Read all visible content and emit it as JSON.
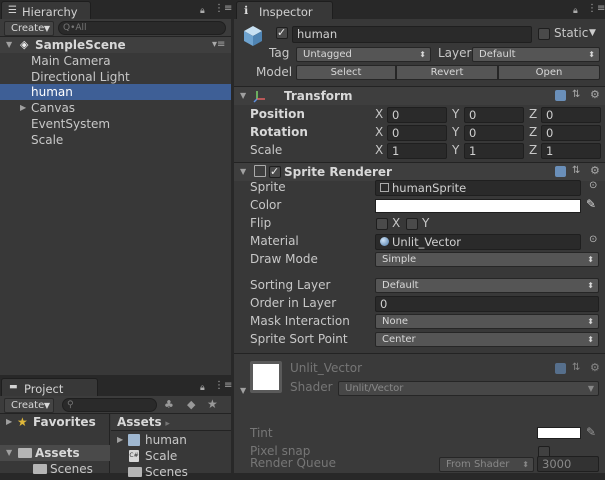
{
  "hierarchy": {
    "tab_label": "Hierarchy",
    "create_label": "Create",
    "search_placeholder": "Q•All",
    "scene_name": "SampleScene",
    "items": [
      "Main Camera",
      "Directional Light",
      "human",
      "Canvas",
      "EventSystem",
      "Scale"
    ],
    "selected_index": 2
  },
  "project": {
    "tab_label": "Project",
    "create_label": "Create",
    "favorites_label": "Favorites",
    "assets_label": "Assets",
    "scenes_label": "Scenes",
    "breadcrumb_label": "Assets",
    "breadcrumb_sep": "▸",
    "files": [
      "human",
      "Scale",
      "Scenes"
    ]
  },
  "inspector": {
    "tab_label": "Inspector",
    "object_name": "human",
    "static_label": "Static",
    "tag_label": "Tag",
    "tag_value": "Untagged",
    "layer_label": "Layer",
    "layer_value": "Default",
    "model_label": "Model",
    "model_buttons": [
      "Select",
      "Revert",
      "Open"
    ],
    "transform": {
      "title": "Transform",
      "rows": [
        {
          "label": "Position",
          "x": "0",
          "y": "0",
          "z": "0"
        },
        {
          "label": "Rotation",
          "x": "0",
          "y": "0",
          "z": "0"
        },
        {
          "label": "Scale",
          "x": "1",
          "y": "1",
          "z": "1"
        }
      ],
      "axis_labels": [
        "X",
        "Y",
        "Z"
      ]
    },
    "sprite_renderer": {
      "title": "Sprite Renderer",
      "sprite_label": "Sprite",
      "sprite_value": "humanSprite",
      "color_label": "Color",
      "color_value": "#ffffff",
      "flip_label": "Flip",
      "flip_x": "X",
      "flip_y": "Y",
      "material_label": "Material",
      "material_value": "Unlit_Vector",
      "draw_mode_label": "Draw Mode",
      "draw_mode_value": "Simple",
      "sorting_layer_label": "Sorting Layer",
      "sorting_layer_value": "Default",
      "order_label": "Order in Layer",
      "order_value": "0",
      "mask_label": "Mask Interaction",
      "mask_value": "None",
      "sort_point_label": "Sprite Sort Point",
      "sort_point_value": "Center"
    },
    "material": {
      "name": "Unlit_Vector",
      "shader_label": "Shader",
      "shader_value": "Unlit/Vector",
      "tint_label": "Tint",
      "pixel_snap_label": "Pixel snap",
      "render_queue_label": "Render Queue",
      "render_queue_mode": "From Shader",
      "render_queue_value": "3000"
    }
  },
  "colors": {
    "panel_bg": "#383838",
    "selection": "#3e5f96",
    "field_bg": "#2a2a2a"
  }
}
